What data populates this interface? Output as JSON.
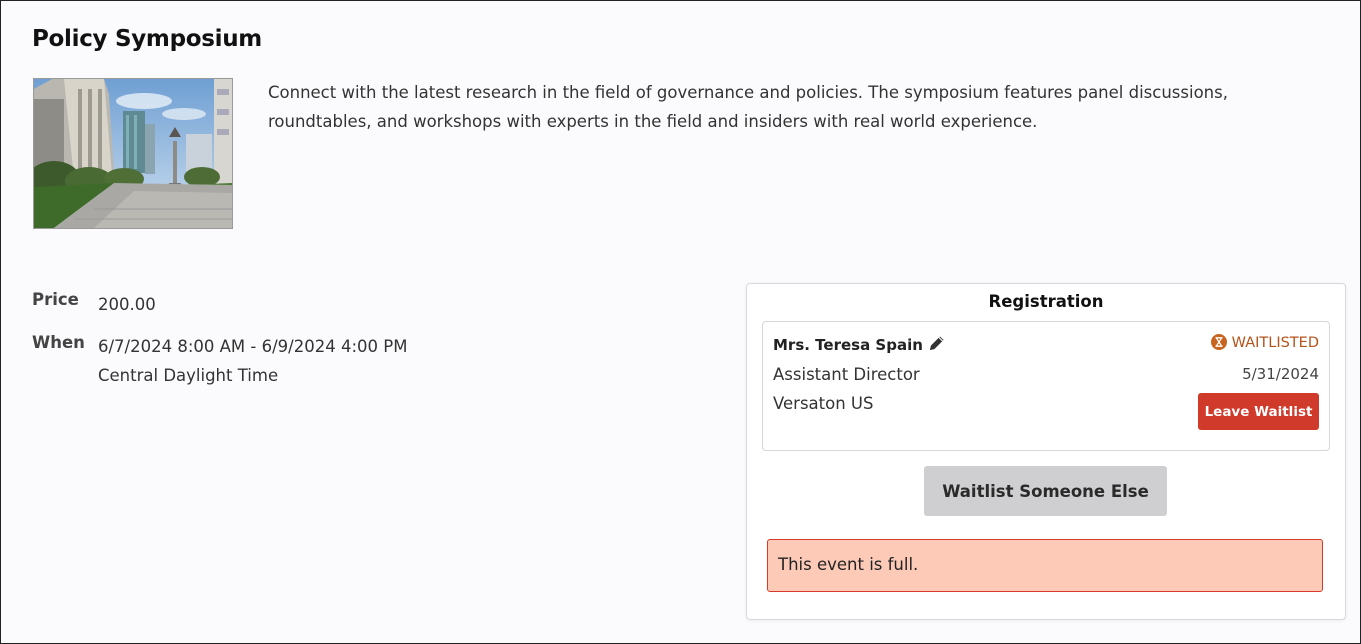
{
  "event": {
    "title": "Policy Symposium",
    "description": "Connect with the latest research in the field of governance and policies. The symposium features panel discussions, roundtables, and workshops with experts in the field and insiders with real world experience.",
    "price_label": "Price",
    "price": "200.00",
    "when_label": "When",
    "when_range": "6/7/2024 8:00 AM - 6/9/2024 4:00 PM",
    "timezone": "Central Daylight Time"
  },
  "registration": {
    "title": "Registration",
    "attendee": {
      "name": "Mrs. Teresa Spain",
      "job_title": "Assistant Director",
      "company": "Versaton US",
      "status": "WAITLISTED",
      "status_date": "5/31/2024",
      "leave_label": "Leave Waitlist"
    },
    "waitlist_other_label": "Waitlist Someone Else",
    "full_message": "This event is full."
  },
  "icons": {
    "edit": "pencil-icon",
    "status": "hourglass-icon"
  },
  "colors": {
    "status_text": "#b5531b",
    "leave_button": "#cf3a2a",
    "alert_bg": "#fdcab8",
    "alert_border": "#d9392b",
    "secondary_button": "#cfcfd1"
  }
}
